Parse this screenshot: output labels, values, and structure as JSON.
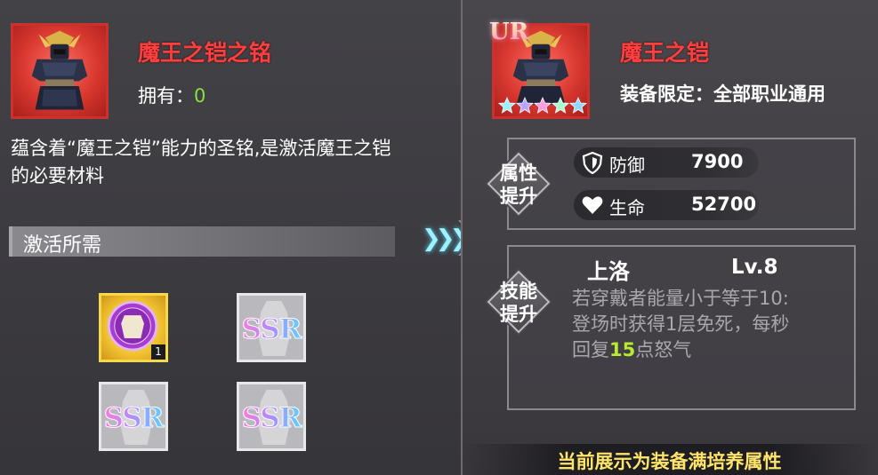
{
  "material": {
    "name": "魔王之铠之铭",
    "own_label": "拥有：",
    "own_count": "0",
    "description": "蕴含着“魔王之铠”能力的圣铭,是激活魔王之铠的必要材料"
  },
  "requirements": {
    "title": "激活所需",
    "slots": [
      {
        "type": "item",
        "count": "1"
      },
      {
        "type": "SSR",
        "label": "SSR"
      },
      {
        "type": "SSR",
        "label": "SSR"
      },
      {
        "type": "SSR",
        "label": "SSR"
      }
    ]
  },
  "arrow_icon": "triple-chevron-right",
  "equipment": {
    "rarity": "UR",
    "stars": 5,
    "name": "魔王之铠",
    "limit_label": "装备限定：",
    "limit_value": "全部职业通用"
  },
  "attributes": {
    "section_label_1": "属性",
    "section_label_2": "提升",
    "stats": [
      {
        "icon": "shield-icon",
        "name": "防御",
        "value": "7900"
      },
      {
        "icon": "heart-icon",
        "name": "生命",
        "value": "52700"
      }
    ]
  },
  "skill": {
    "section_label_1": "技能",
    "section_label_2": "提升",
    "name": "上洛",
    "level": "Lv.8",
    "desc_line1": "若穿戴者能量小于等于10:",
    "desc_line2": "登场时获得1层免死，每秒",
    "desc_line3_pre": "回复",
    "desc_line3_hl": "15",
    "desc_line3_post": "点怒气"
  },
  "footer_note": "当前展示为装备满培养属性",
  "colors": {
    "title_red": "#ff3f3f",
    "own_green": "#86e13c",
    "highlight_green": "#b9ea2f",
    "footer_yellow": "#ffe46a"
  }
}
